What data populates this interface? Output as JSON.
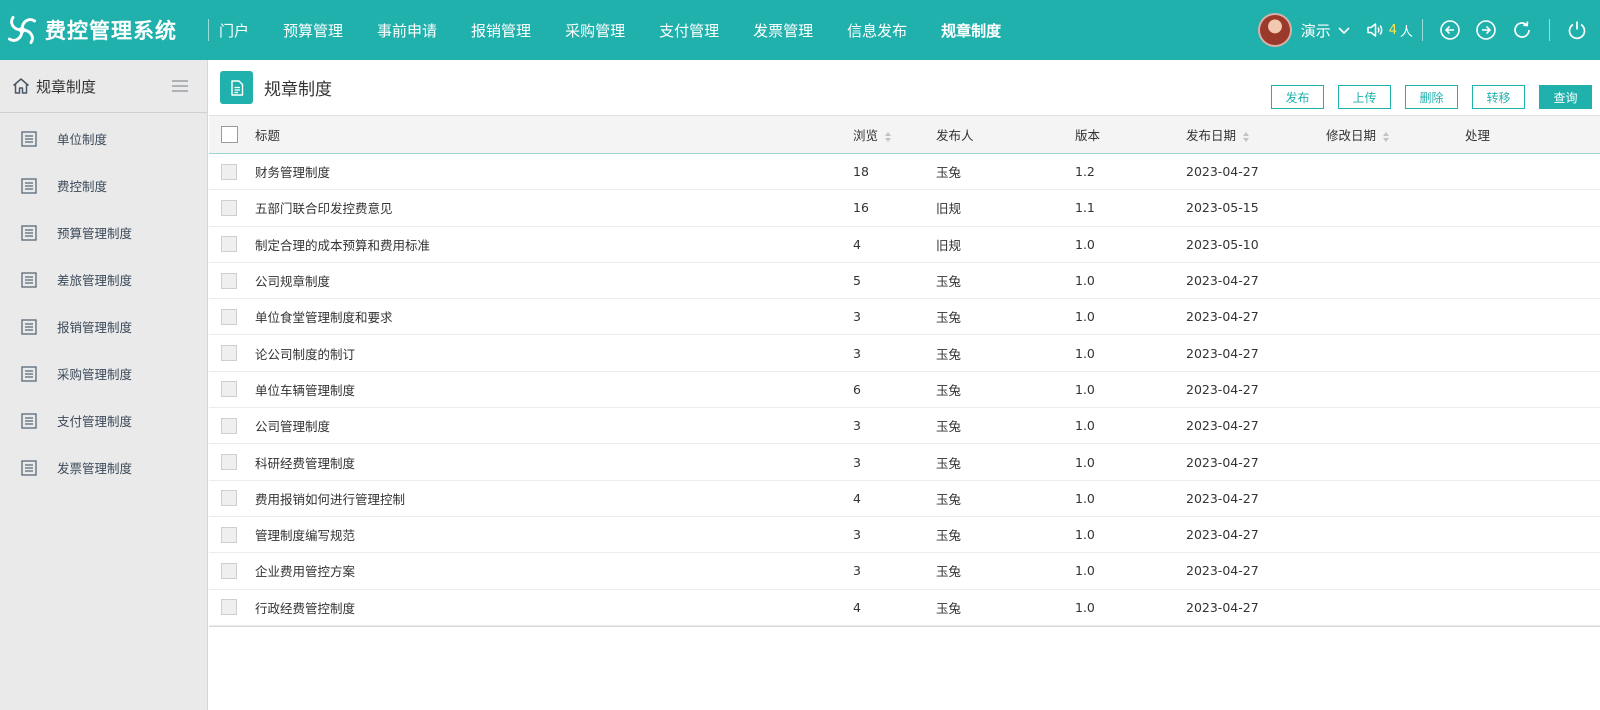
{
  "app": {
    "title": "费控管理系统"
  },
  "nav": {
    "items": [
      {
        "label": "门户"
      },
      {
        "label": "预算管理"
      },
      {
        "label": "事前申请"
      },
      {
        "label": "报销管理"
      },
      {
        "label": "采购管理"
      },
      {
        "label": "支付管理"
      },
      {
        "label": "发票管理"
      },
      {
        "label": "信息发布"
      },
      {
        "label": "规章制度",
        "active": true
      }
    ]
  },
  "user": {
    "name": "演示",
    "online_count": "4",
    "online_unit": "人"
  },
  "sidebar": {
    "title": "规章制度",
    "items": [
      {
        "label": "单位制度"
      },
      {
        "label": "费控制度"
      },
      {
        "label": "预算管理制度"
      },
      {
        "label": "差旅管理制度"
      },
      {
        "label": "报销管理制度"
      },
      {
        "label": "采购管理制度"
      },
      {
        "label": "支付管理制度"
      },
      {
        "label": "发票管理制度"
      }
    ]
  },
  "page": {
    "title": "规章制度",
    "actions": {
      "publish": "发布",
      "upload": "上传",
      "delete": "删除",
      "transfer": "转移",
      "query": "查询"
    }
  },
  "table": {
    "columns": {
      "title": "标题",
      "views": "浏览",
      "publisher": "发布人",
      "version": "版本",
      "publish_date": "发布日期",
      "modify_date": "修改日期",
      "operation": "处理"
    },
    "rows": [
      {
        "title": "财务管理制度",
        "views": "18",
        "publisher": "玉兔",
        "version": "1.2",
        "publish_date": "2023-04-27",
        "modify_date": "",
        "operation": ""
      },
      {
        "title": "五部门联合印发控费意见",
        "views": "16",
        "publisher": "旧规",
        "version": "1.1",
        "publish_date": "2023-05-15",
        "modify_date": "",
        "operation": ""
      },
      {
        "title": "制定合理的成本预算和费用标准",
        "views": "4",
        "publisher": "旧规",
        "version": "1.0",
        "publish_date": "2023-05-10",
        "modify_date": "",
        "operation": ""
      },
      {
        "title": "公司规章制度",
        "views": "5",
        "publisher": "玉兔",
        "version": "1.0",
        "publish_date": "2023-04-27",
        "modify_date": "",
        "operation": ""
      },
      {
        "title": "单位食堂管理制度和要求",
        "views": "3",
        "publisher": "玉兔",
        "version": "1.0",
        "publish_date": "2023-04-27",
        "modify_date": "",
        "operation": ""
      },
      {
        "title": "论公司制度的制订",
        "views": "3",
        "publisher": "玉兔",
        "version": "1.0",
        "publish_date": "2023-04-27",
        "modify_date": "",
        "operation": ""
      },
      {
        "title": "单位车辆管理制度",
        "views": "6",
        "publisher": "玉兔",
        "version": "1.0",
        "publish_date": "2023-04-27",
        "modify_date": "",
        "operation": ""
      },
      {
        "title": "公司管理制度",
        "views": "3",
        "publisher": "玉兔",
        "version": "1.0",
        "publish_date": "2023-04-27",
        "modify_date": "",
        "operation": ""
      },
      {
        "title": "科研经费管理制度",
        "views": "3",
        "publisher": "玉兔",
        "version": "1.0",
        "publish_date": "2023-04-27",
        "modify_date": "",
        "operation": ""
      },
      {
        "title": "费用报销如何进行管理控制",
        "views": "4",
        "publisher": "玉兔",
        "version": "1.0",
        "publish_date": "2023-04-27",
        "modify_date": "",
        "operation": ""
      },
      {
        "title": "管理制度编写规范",
        "views": "3",
        "publisher": "玉兔",
        "version": "1.0",
        "publish_date": "2023-04-27",
        "modify_date": "",
        "operation": ""
      },
      {
        "title": "企业费用管控方案",
        "views": "3",
        "publisher": "玉兔",
        "version": "1.0",
        "publish_date": "2023-04-27",
        "modify_date": "",
        "operation": ""
      },
      {
        "title": "行政经费管控制度",
        "views": "4",
        "publisher": "玉兔",
        "version": "1.0",
        "publish_date": "2023-04-27",
        "modify_date": "",
        "operation": ""
      }
    ]
  },
  "colors": {
    "brand": "#20b1ad",
    "online_count": "#ffe34d",
    "sidebar_bg": "#eaeaea"
  }
}
